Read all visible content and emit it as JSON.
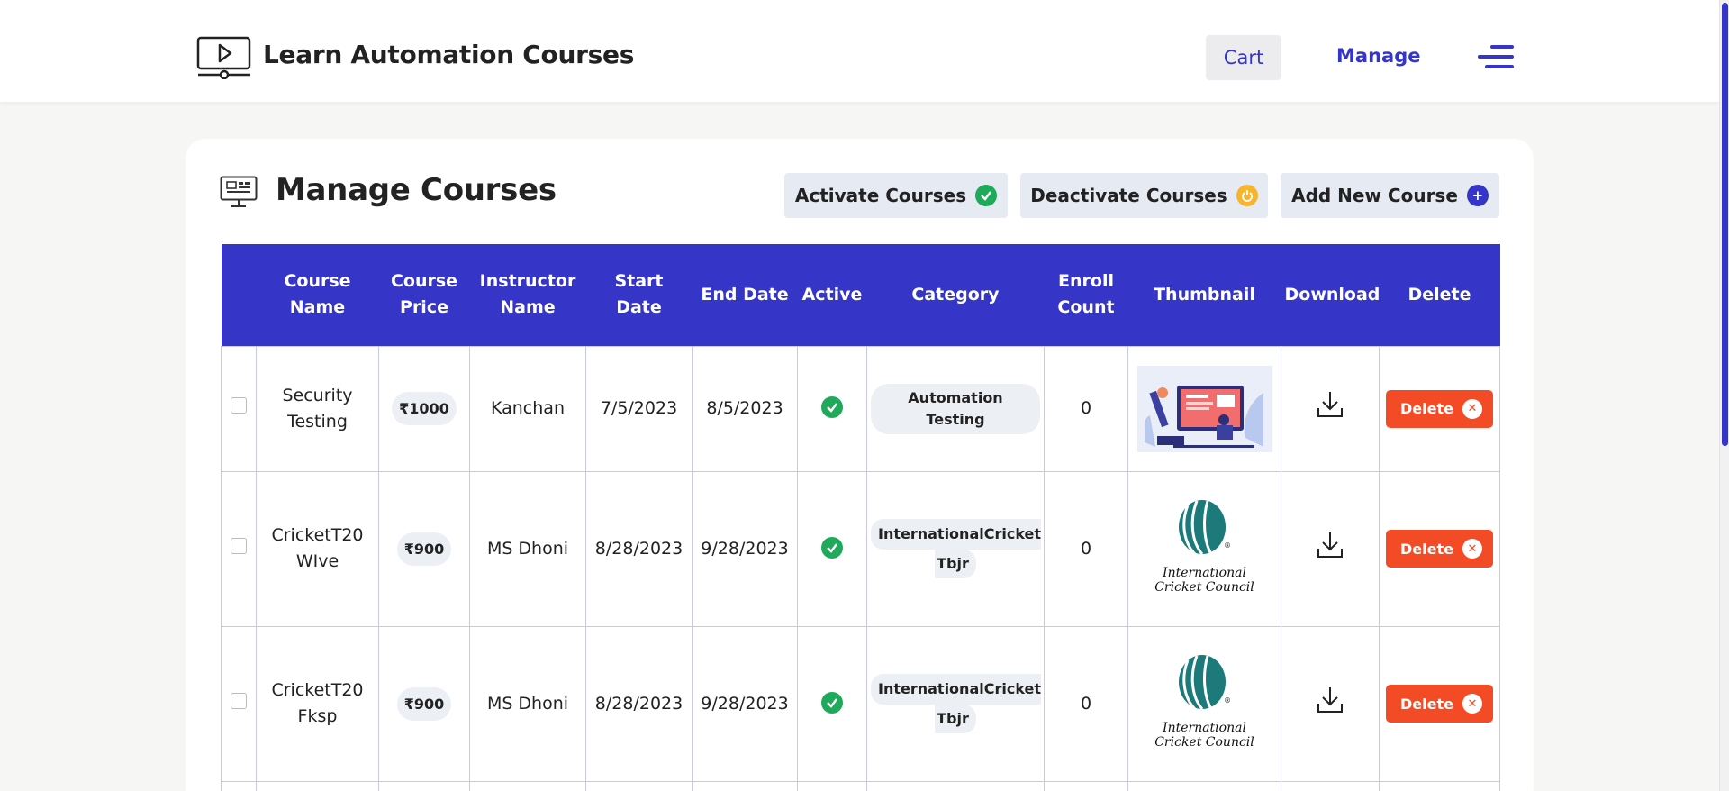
{
  "header": {
    "brand": "Learn Automation Courses",
    "cart_label": "Cart",
    "manage_label": "Manage"
  },
  "page": {
    "title": "Manage Courses",
    "actions": {
      "activate": "Activate Courses",
      "deactivate": "Deactivate Courses",
      "add": "Add New Course"
    }
  },
  "colors": {
    "accent": "#3535c8",
    "delete": "#f24b25",
    "active": "#1eaa5a",
    "warn": "#f5b52e"
  },
  "table": {
    "headers": {
      "name_1": "Course",
      "name_2": "Name",
      "price_1": "Course",
      "price_2": "Price",
      "instructor_1": "Instructor",
      "instructor_2": "Name",
      "start": "Start Date",
      "end": "End Date",
      "active": "Active",
      "category": "Category",
      "enroll_1": "Enroll",
      "enroll_2": "Count",
      "thumbnail": "Thumbnail",
      "download": "Download",
      "delete": "Delete"
    },
    "rows": [
      {
        "name_1": "Security",
        "name_2": "Testing",
        "price": "₹1000",
        "instructor": "Kanchan",
        "start": "7/5/2023",
        "end": "8/5/2023",
        "active": true,
        "category_1": "Automation Testing",
        "category_2": "",
        "enroll": "0",
        "thumbnail": "automation-illustration",
        "delete_label": "Delete"
      },
      {
        "name_1": "CricketT20",
        "name_2": "WIve",
        "price": "₹900",
        "instructor": "MS Dhoni",
        "start": "8/28/2023",
        "end": "9/28/2023",
        "active": true,
        "category_1": "InternationalCricket",
        "category_2": "Tbjr",
        "enroll": "0",
        "thumbnail_text_1": "International",
        "thumbnail_text_2": "Cricket Council",
        "delete_label": "Delete"
      },
      {
        "name_1": "CricketT20",
        "name_2": "Fksp",
        "price": "₹900",
        "instructor": "MS Dhoni",
        "start": "8/28/2023",
        "end": "9/28/2023",
        "active": true,
        "category_1": "InternationalCricket",
        "category_2": "Tbjr",
        "enroll": "0",
        "thumbnail_text_1": "International",
        "thumbnail_text_2": "Cricket Council",
        "delete_label": "Delete"
      }
    ]
  }
}
